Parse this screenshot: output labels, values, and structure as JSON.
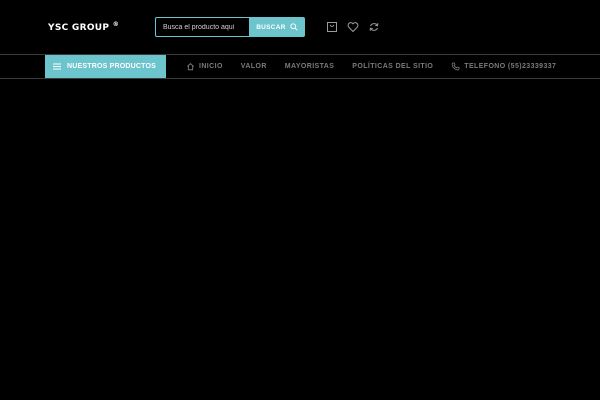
{
  "header": {
    "logo_text": "YSC GROUP",
    "logo_mark": "®",
    "search": {
      "placeholder": "Busca el producto aquí",
      "button_label": "BUSCAR"
    },
    "icons": [
      "cart-icon",
      "heart-icon",
      "refresh-icon"
    ]
  },
  "nav": {
    "products_label": "NUESTROS PRODUCTOS",
    "items": [
      {
        "label": "INICIO",
        "icon": "home-icon"
      },
      {
        "label": "VALOR"
      },
      {
        "label": "MAYORISTAS"
      },
      {
        "label": "POLÍTICAS DEL SITIO"
      },
      {
        "label": "TELEFONO (55)23339337",
        "icon": "phone-icon"
      }
    ]
  },
  "colors": {
    "accent": "#6cc4cd",
    "background": "#000000",
    "nav_text": "#7a7a7a"
  }
}
